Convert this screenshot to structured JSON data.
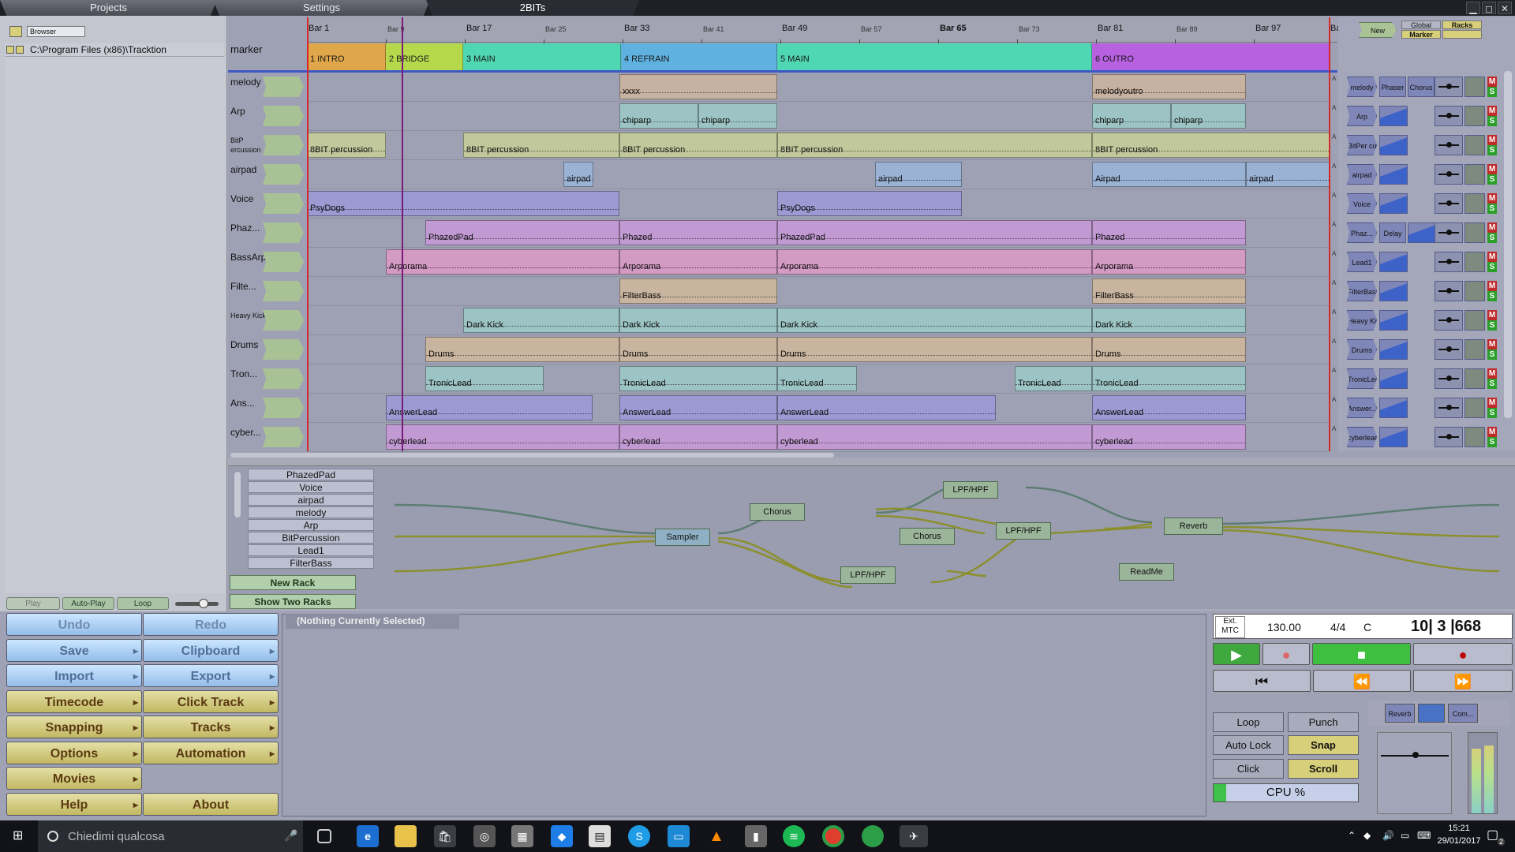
{
  "tabs": [
    "Projects",
    "Settings",
    "2BITs"
  ],
  "browser": {
    "dropdown": "Browser",
    "path": "C:\\Program Files (x86)\\Tracktion"
  },
  "playback": {
    "play": "Play",
    "autoplay": "Auto-Play",
    "loop": "Loop"
  },
  "ruler": [
    "Bar 1",
    "Bar 9",
    "Bar 17",
    "Bar 25",
    "Bar 33",
    "Bar 41",
    "Bar 49",
    "Bar 57",
    "Bar 65",
    "Bar 73",
    "Bar 81",
    "Bar 89",
    "Bar 97",
    "Bar"
  ],
  "marker_label": "marker",
  "markers": [
    {
      "label": "1 INTRO",
      "color": "#e0a64a"
    },
    {
      "label": "2 BRIDGE",
      "color": "#b6d94c"
    },
    {
      "label": "3 MAIN",
      "color": "#4fd6b2"
    },
    {
      "label": "4 REFRAIN",
      "color": "#5fb1e0"
    },
    {
      "label": "5 MAIN",
      "color": "#4fd6b2"
    },
    {
      "label": "6 OUTRO",
      "color": "#b760e0"
    }
  ],
  "tracks": [
    {
      "name": "melody",
      "clips": [
        {
          "label": "xxxx"
        },
        {
          "label": "melodyoutro"
        }
      ],
      "color": "#c7b1a0"
    },
    {
      "name": "Arp",
      "clips": [
        {
          "label": "chiparp"
        },
        {
          "label": "chiparp"
        },
        {
          "label": "chiparp"
        },
        {
          "label": "chiparp"
        }
      ],
      "color": "#9dc4c4"
    },
    {
      "name": "BitP ercussion",
      "clips": [
        {
          "label": "8BIT percussion"
        },
        {
          "label": "8BIT percussion"
        },
        {
          "label": "8BIT percussion"
        },
        {
          "label": "8BIT percussion"
        },
        {
          "label": "8BIT percussion"
        }
      ],
      "color": "#c1c99c"
    },
    {
      "name": "airpad",
      "clips": [
        {
          "label": "airpad"
        },
        {
          "label": "airpad"
        },
        {
          "label": "Airpad"
        },
        {
          "label": "airpad"
        }
      ],
      "color": "#9ab2d3"
    },
    {
      "name": "Voice",
      "clips": [
        {
          "label": "PsyDogs"
        },
        {
          "label": "PsyDogs"
        }
      ],
      "color": "#9b9ad3"
    },
    {
      "name": "Phaz...",
      "clips": [
        {
          "label": "PhazedPad"
        },
        {
          "label": "Phazed"
        },
        {
          "label": "PhazedPad"
        },
        {
          "label": "Phazed"
        }
      ],
      "color": "#c29ad3"
    },
    {
      "name": "BassArp",
      "clips": [
        {
          "label": "Arporama"
        },
        {
          "label": "Arporama"
        },
        {
          "label": "Arporama"
        },
        {
          "label": "Arporama"
        }
      ],
      "color": "#d39ac3"
    },
    {
      "name": "Filte...",
      "clips": [
        {
          "label": "FilterBass"
        },
        {
          "label": "FilterBass"
        }
      ],
      "color": "#c8b49f"
    },
    {
      "name": "Heavy Kick",
      "clips": [
        {
          "label": "Dark Kick"
        },
        {
          "label": "Dark Kick"
        },
        {
          "label": "Dark Kick"
        },
        {
          "label": "Dark Kick"
        }
      ],
      "color": "#9dc4c4"
    },
    {
      "name": "Drums",
      "clips": [
        {
          "label": "Drums"
        },
        {
          "label": "Drums"
        },
        {
          "label": "Drums"
        },
        {
          "label": "Drums"
        }
      ],
      "color": "#c8b49f"
    },
    {
      "name": "Tron...",
      "clips": [
        {
          "label": "TronicLead"
        },
        {
          "label": "TronicLead"
        },
        {
          "label": "TronicLead"
        },
        {
          "label": "TronicLead"
        },
        {
          "label": "TronicLead"
        }
      ],
      "color": "#9dc4c4"
    },
    {
      "name": "Ans...",
      "clips": [
        {
          "label": "AnswerLead"
        },
        {
          "label": "AnswerLead"
        },
        {
          "label": "AnswerLead"
        },
        {
          "label": "AnswerLead"
        }
      ],
      "color": "#9b9ad3"
    },
    {
      "name": "cyber...",
      "clips": [
        {
          "label": "cyberlead"
        },
        {
          "label": "cyberlead"
        },
        {
          "label": "cyberlead"
        },
        {
          "label": "cyberlead"
        }
      ],
      "color": "#c29ad3"
    }
  ],
  "rack_top": {
    "new_filter": "New Filter...",
    "global": "Global",
    "racks": "Racks",
    "marker": "Marker"
  },
  "rack_rows": [
    {
      "name": "melody",
      "plugins": [
        "Phaser",
        "Chorus"
      ]
    },
    {
      "name": "Arp",
      "plugins": []
    },
    {
      "name": "BitPer cussion",
      "plugins": []
    },
    {
      "name": "airpad",
      "plugins": []
    },
    {
      "name": "Voice",
      "plugins": []
    },
    {
      "name": "Phaz...",
      "plugins": [
        "Delay"
      ]
    },
    {
      "name": "Lead1",
      "plugins": []
    },
    {
      "name": "FilterBass",
      "plugins": []
    },
    {
      "name": "Heavy Kick",
      "plugins": []
    },
    {
      "name": "Drums",
      "plugins": []
    },
    {
      "name": "TronicLead",
      "plugins": []
    },
    {
      "name": "Answer...",
      "plugins": []
    },
    {
      "name": "cyberlead",
      "plugins": []
    }
  ],
  "rack_list": [
    "PhazedPad",
    "Voice",
    "airpad",
    "melody",
    "Arp",
    "BitPercussion",
    "Lead1",
    "FilterBass"
  ],
  "rack_buttons": {
    "new_rack": "New Rack",
    "show_two": "Show Two Racks"
  },
  "rack_nodes": [
    "Sampler",
    "Chorus",
    "LPF/HPF",
    "Chorus",
    "LPF/HPF",
    "LPF/HPF",
    "Reverb",
    "ReadMe"
  ],
  "left_buttons": [
    [
      "Undo",
      "Redo"
    ],
    [
      "Save",
      "Clipboard"
    ],
    [
      "Import",
      "Export"
    ],
    [
      "Timecode",
      "Click Track"
    ],
    [
      "Snapping",
      "Tracks"
    ],
    [
      "Options",
      "Automation"
    ],
    [
      "Movies",
      ""
    ],
    [
      "Help",
      "About"
    ]
  ],
  "properties": {
    "tab": "(Nothing Currently Selected)"
  },
  "transport": {
    "sync": "Ext. MTC",
    "tempo": "130.00",
    "timesig": "4/4",
    "key": "C",
    "position": "10| 3 |668",
    "loop": "Loop",
    "punch": "Punch",
    "autolock": "Auto Lock",
    "snap": "Snap",
    "click": "Click",
    "scroll": "Scroll",
    "cpu": "CPU %",
    "plugins": [
      "Reverb",
      "Com..."
    ]
  },
  "taskbar": {
    "search": "Chiedimi qualcosa",
    "time": "15:21",
    "date": "29/01/2017",
    "notif": "2"
  },
  "colors": {
    "playhead": "#7a1b7a",
    "cursor": "#d62828",
    "green": "#3fc24a"
  }
}
